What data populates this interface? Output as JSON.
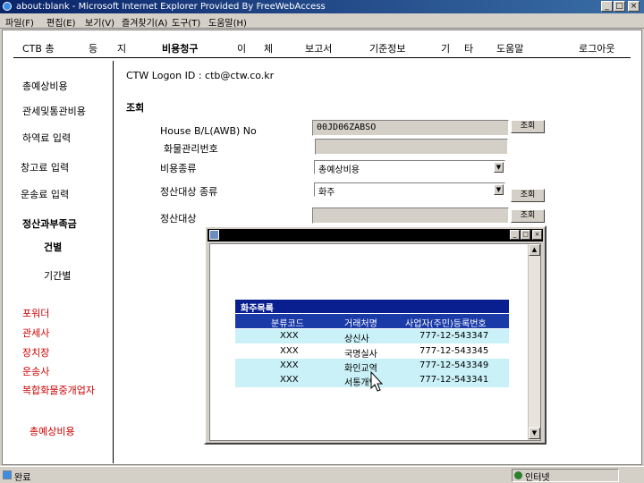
{
  "window": {
    "title": "about:blank - Microsoft Internet Explorer Provided By FreeWebAccess",
    "controls": [
      "_",
      "□",
      "×"
    ]
  },
  "menubar": [
    "파일(F)",
    "편집(E)",
    "보기(V)",
    "즐겨찾기(A)",
    "도구(T)",
    "도움말(H)"
  ],
  "topnav": [
    "CTB 총",
    "등",
    "지",
    "비용청구",
    "이",
    "체",
    "보고서",
    "기준정보",
    "기",
    "타",
    "도움말",
    "로그아웃"
  ],
  "sidebar": {
    "items": [
      "총예상비용",
      "관세및통관비용",
      "하역료 입력",
      "창고료 입력",
      "운송료 입력",
      "정산과부족금",
      "건별",
      "기간별"
    ],
    "red_items": [
      "포워더",
      "관세사",
      "장치장",
      "운송사",
      "복합화물중개업자",
      "총예상비용"
    ]
  },
  "main": {
    "logon": "CTW Logon ID : ctb@ctw.co.kr",
    "section": "조회",
    "fields": {
      "hbl_label": "House B/L(AWB) No",
      "hbl_value": "00JD06ZABSO",
      "cargo_label": "화물관리번호",
      "cargo_value": "",
      "cost_type_label": "비용종류",
      "cost_type_value": "총예상비용",
      "settle_type_label": "정산대상 종류",
      "settle_type_value": "화주",
      "settle_target_label": "정산대상",
      "settle_target_value": ""
    },
    "buttons": {
      "lookup": "조회"
    }
  },
  "popup": {
    "title": "화주목록",
    "columns": [
      "분류코드",
      "거래처명",
      "사업자(주민)등록번호"
    ],
    "rows": [
      [
        "XXX",
        "상신사",
        "777-12-543347"
      ],
      [
        "XXX",
        "국명실사",
        "777-12-543345"
      ],
      [
        "XXX",
        "화인교역",
        "777-12-543349"
      ],
      [
        "XXX",
        "서통개인",
        "777-12-543341"
      ]
    ]
  },
  "statusbar": {
    "text": "완료",
    "zone": "인터넷"
  },
  "colors": {
    "table_header": "#1a3aa8",
    "table_alt_row": "#c9f1f7",
    "sidebar_red": "#cc0000"
  }
}
